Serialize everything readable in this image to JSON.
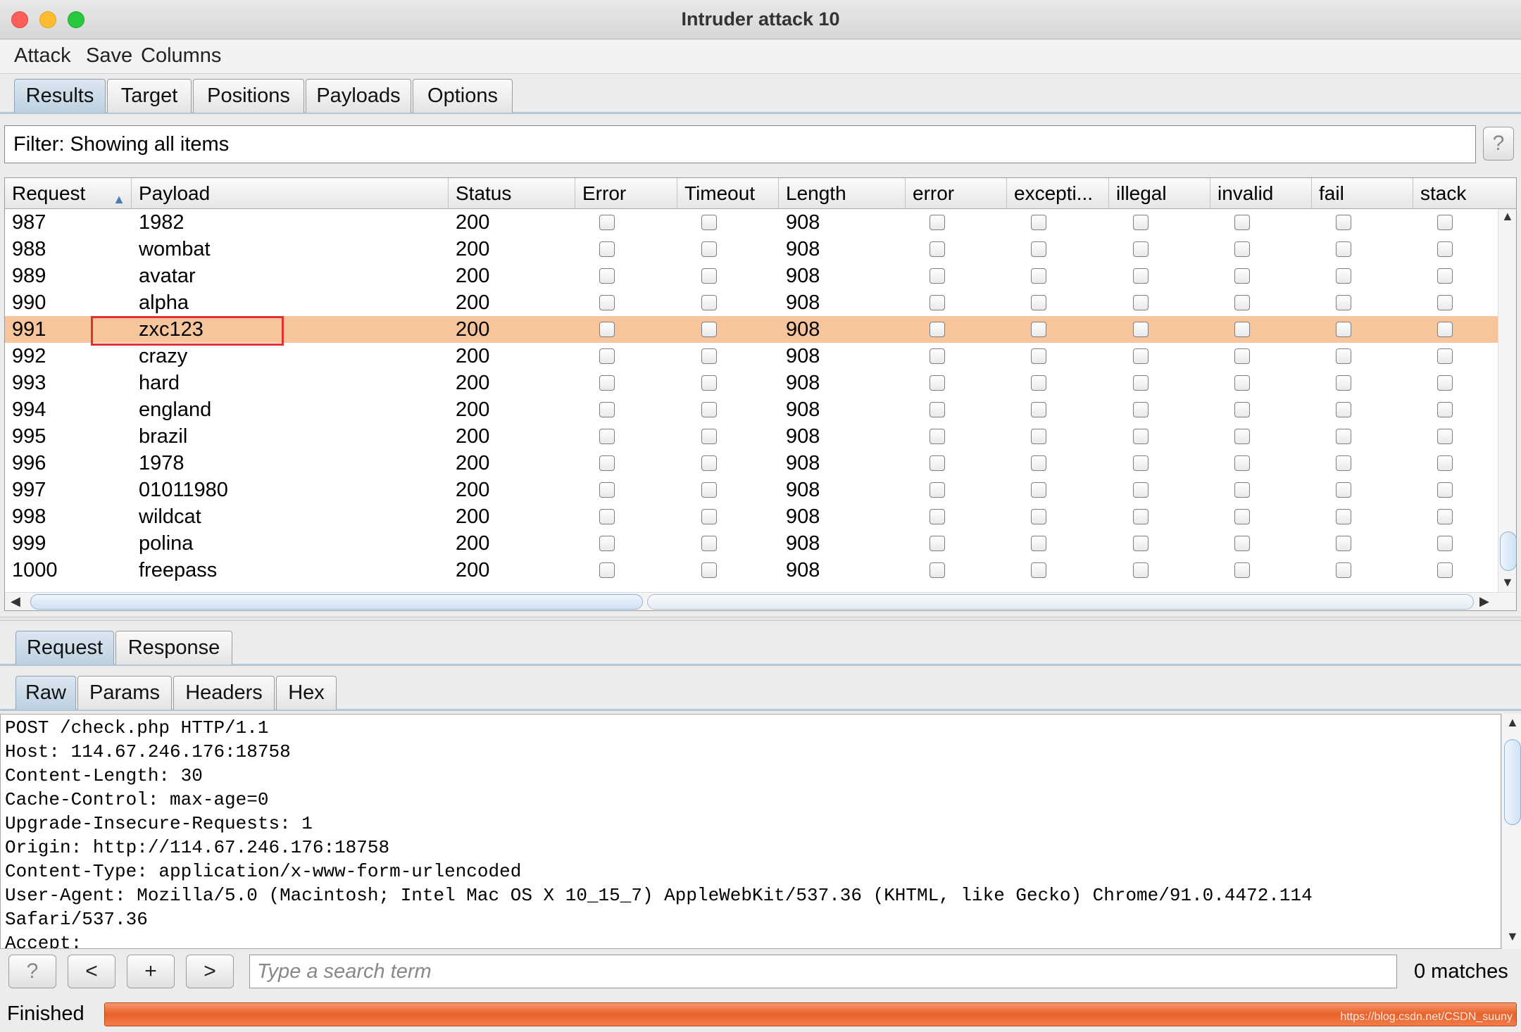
{
  "window": {
    "title": "Intruder attack 10"
  },
  "menu": [
    "Attack",
    "Save",
    "Columns"
  ],
  "tabs": [
    "Results",
    "Target",
    "Positions",
    "Payloads",
    "Options"
  ],
  "filter": {
    "text": "Filter: Showing all items",
    "help": "?"
  },
  "table": {
    "columns": [
      "Request",
      "Payload",
      "Status",
      "Error",
      "Timeout",
      "Length",
      "error",
      "excepti...",
      "illegal",
      "invalid",
      "fail",
      "stack"
    ],
    "sorted_column": "Request",
    "rows": [
      {
        "request": "987",
        "payload": "1982",
        "status": "200",
        "length": "908"
      },
      {
        "request": "988",
        "payload": "wombat",
        "status": "200",
        "length": "908"
      },
      {
        "request": "989",
        "payload": "avatar",
        "status": "200",
        "length": "908"
      },
      {
        "request": "990",
        "payload": "alpha",
        "status": "200",
        "length": "908"
      },
      {
        "request": "991",
        "payload": "zxc123",
        "status": "200",
        "length": "908"
      },
      {
        "request": "992",
        "payload": "crazy",
        "status": "200",
        "length": "908"
      },
      {
        "request": "993",
        "payload": "hard",
        "status": "200",
        "length": "908"
      },
      {
        "request": "994",
        "payload": "england",
        "status": "200",
        "length": "908"
      },
      {
        "request": "995",
        "payload": "brazil",
        "status": "200",
        "length": "908"
      },
      {
        "request": "996",
        "payload": "1978",
        "status": "200",
        "length": "908"
      },
      {
        "request": "997",
        "payload": "01011980",
        "status": "200",
        "length": "908"
      },
      {
        "request": "998",
        "payload": "wildcat",
        "status": "200",
        "length": "908"
      },
      {
        "request": "999",
        "payload": "polina",
        "status": "200",
        "length": "908"
      },
      {
        "request": "1000",
        "payload": "freepass",
        "status": "200",
        "length": "908"
      }
    ],
    "selected_row": 4
  },
  "detail_tabs": [
    "Request",
    "Response"
  ],
  "view_tabs": [
    "Raw",
    "Params",
    "Headers",
    "Hex"
  ],
  "raw_lines": [
    "POST /check.php HTTP/1.1",
    "Host: 114.67.246.176:18758",
    "Content-Length: 30",
    "Cache-Control: max-age=0",
    "Upgrade-Insecure-Requests: 1",
    "Origin: http://114.67.246.176:18758",
    "Content-Type: application/x-www-form-urlencoded",
    "User-Agent: Mozilla/5.0 (Macintosh; Intel Mac OS X 10_15_7) AppleWebKit/537.36 (KHTML, like Gecko) Chrome/91.0.4472.114",
    "Safari/537.36",
    "Accept:"
  ],
  "search": {
    "help": "?",
    "prev": "<",
    "add": "+",
    "next": ">",
    "placeholder": "Type a search term",
    "matches": "0 matches"
  },
  "status": {
    "label": "Finished",
    "progress": 1.0
  },
  "watermark": "https://blog.csdn.net/CSDN_suuny",
  "colors": {
    "selected_row": "#f6c59b",
    "progress": "#e8602a",
    "highlight_box": "#e03030"
  }
}
